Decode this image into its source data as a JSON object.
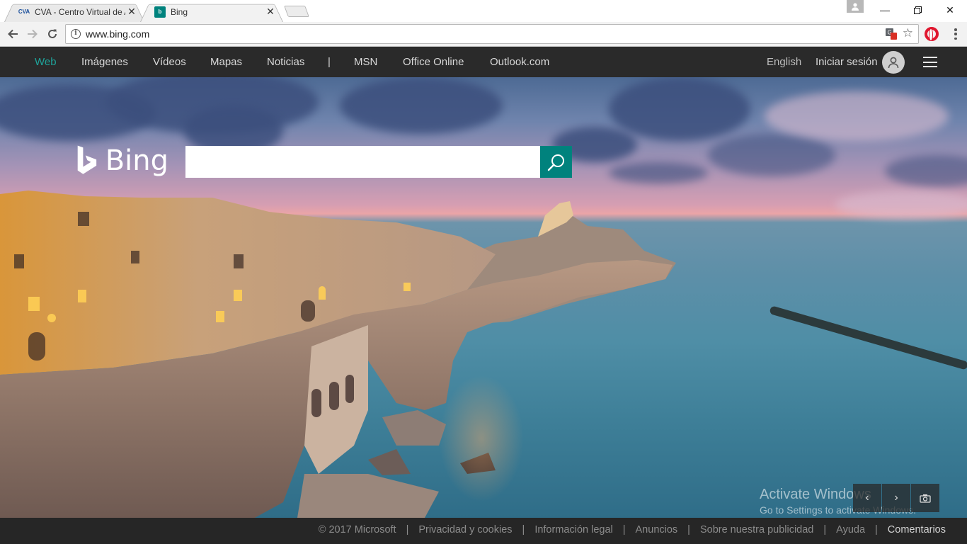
{
  "browser": {
    "tabs": [
      {
        "title": "CVA - Centro Virtual de A",
        "favicon": "cva-favicon"
      },
      {
        "title": "Bing",
        "favicon": "bing-favicon"
      }
    ],
    "url": "www.bing.com",
    "icons": {
      "back": "back-arrow-icon",
      "forward": "forward-arrow-icon",
      "reload": "reload-icon",
      "info": "info-icon",
      "translate": "translate-icon",
      "bookmark": "star-icon",
      "extension": "opera-icon",
      "menu": "kebab-menu-icon"
    }
  },
  "bing": {
    "nav": [
      {
        "label": "Web",
        "active": true
      },
      {
        "label": "Imágenes"
      },
      {
        "label": "Vídeos"
      },
      {
        "label": "Mapas"
      },
      {
        "label": "Noticias"
      },
      {
        "label": "|"
      },
      {
        "label": "MSN"
      },
      {
        "label": "Office Online"
      },
      {
        "label": "Outlook.com"
      }
    ],
    "language": "English",
    "signin": "Iniciar sesión",
    "logo_text": "Bing",
    "search": {
      "value": "",
      "placeholder": ""
    },
    "accent_color": "#00827d",
    "watermark": {
      "line1": "Activate Windows",
      "line2": "Go to Settings to activate Windows."
    },
    "footer": [
      "© 2017 Microsoft",
      "Privacidad y cookies",
      "Información legal",
      "Anuncios",
      "Sobre nuestra publicidad",
      "Ayuda",
      "Comentarios"
    ]
  }
}
